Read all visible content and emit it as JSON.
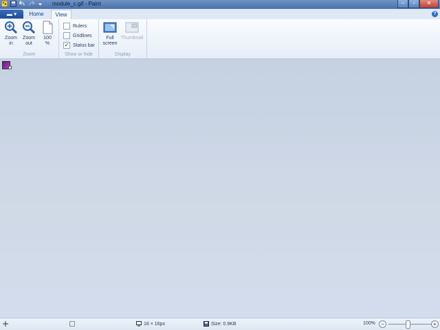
{
  "window": {
    "title": "module_c.gif - Paint"
  },
  "tabs": {
    "home": "Home",
    "view": "View"
  },
  "ribbon": {
    "zoom": {
      "label": "Zoom",
      "zoom_in_line1": "Zoom",
      "zoom_in_line2": "in",
      "zoom_out_line1": "Zoom",
      "zoom_out_line2": "out",
      "hundred_line1": "100",
      "hundred_line2": "%"
    },
    "show": {
      "label": "Show or hide",
      "rulers": "Rulers",
      "rulers_checked": false,
      "gridlines": "Gridlines",
      "gridlines_checked": false,
      "statusbar": "Status bar",
      "statusbar_checked": true
    },
    "display": {
      "label": "Display",
      "full_line1": "Full",
      "full_line2": "screen",
      "thumbnail": "Thumbnail"
    }
  },
  "statusbar": {
    "dimensions": "16 × 16px",
    "size": "Size: 0.9KB",
    "zoom": "100%",
    "zoom_level": 1.0
  },
  "colors": {
    "accent": "#2e6bc1",
    "titlebar": "#4a71ad",
    "workspace": "#cdd7e6"
  }
}
